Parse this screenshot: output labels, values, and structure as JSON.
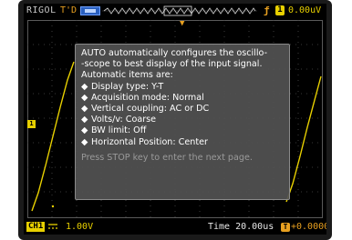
{
  "topbar": {
    "brand": "RIGOL",
    "acq_state": "T'D",
    "trigger_source": "1",
    "trigger_level": "0.00uV"
  },
  "popup": {
    "line1": "AUTO automatically configures the oscillo-",
    "line2": "-scope  to  best display of the input signal.",
    "line3": "Automatic items are:",
    "items": [
      "Display type: Y-T",
      "Acquisition mode: Normal",
      "Vertical coupling: AC or DC",
      "Volts/v: Coarse",
      "BW limit: Off",
      "Horizontal Position: Center"
    ],
    "hint": "Press STOP key to enter the next page."
  },
  "bottombar": {
    "ch1_label": "CH1",
    "ch1_scale": "1.00V",
    "timebase": "Time 20.00us",
    "trig_pos_icon": "T",
    "trig_pos": "+0.0000s"
  },
  "markers": {
    "ch1_marker": "1",
    "trigpos_marker": "▼"
  },
  "colors": {
    "ch1": "#e8d000",
    "trigger": "#e8a020",
    "screen_bg": "#000000",
    "popup_bg": "#525252",
    "memory_bar": "#2a60c0"
  },
  "icons": {
    "bullet": "◆",
    "trigger_edge": "rising-edge-icon"
  }
}
